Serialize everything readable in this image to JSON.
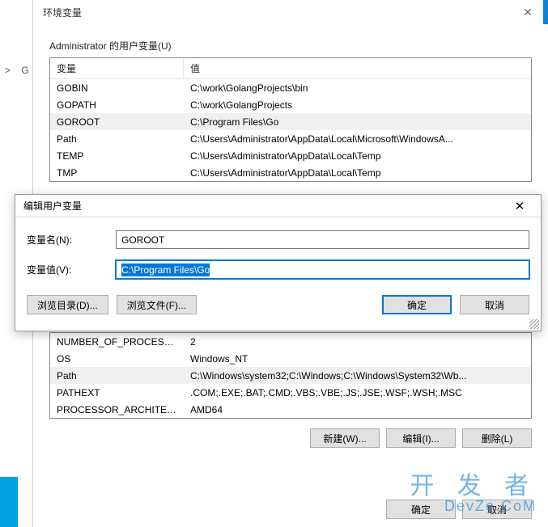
{
  "breadcrumb_sep": ">",
  "breadcrumb_item": "G",
  "main_dialog": {
    "title": "环境变量",
    "user_section_label": "Administrator 的用户变量(U)",
    "headers": {
      "name": "变量",
      "value": "值"
    },
    "user_vars": [
      {
        "name": "GOBIN",
        "value": "C:\\work\\GolangProjects\\bin"
      },
      {
        "name": "GOPATH",
        "value": "C:\\work\\GolangProjects"
      },
      {
        "name": "GOROOT",
        "value": "C:\\Program Files\\Go",
        "selected": true
      },
      {
        "name": "Path",
        "value": "C:\\Users\\Administrator\\AppData\\Local\\Microsoft\\WindowsA..."
      },
      {
        "name": "TEMP",
        "value": "C:\\Users\\Administrator\\AppData\\Local\\Temp"
      },
      {
        "name": "TMP",
        "value": "C:\\Users\\Administrator\\AppData\\Local\\Temp"
      }
    ],
    "system_vars": [
      {
        "name": "NUMBER_OF_PROCESSORS",
        "value": "2"
      },
      {
        "name": "OS",
        "value": "Windows_NT"
      },
      {
        "name": "Path",
        "value": "C:\\Windows\\system32;C:\\Windows;C:\\Windows\\System32\\Wb...",
        "selected": true
      },
      {
        "name": "PATHEXT",
        "value": ".COM;.EXE;.BAT;.CMD;.VBS;.VBE;.JS;.JSE;.WSF;.WSH;.MSC"
      },
      {
        "name": "PROCESSOR_ARCHITECT...",
        "value": "AMD64"
      }
    ],
    "buttons": {
      "new": "新建(W)...",
      "edit": "编辑(I)...",
      "delete": "删除(L)",
      "ok": "确定",
      "cancel": "取消"
    }
  },
  "edit_dialog": {
    "title": "编辑用户变量",
    "name_label": "变量名(N):",
    "value_label": "变量值(V):",
    "name_value": "GOROOT",
    "value_value": "C:\\Program Files\\Go",
    "browse_dir": "浏览目录(D)...",
    "browse_file": "浏览文件(F)...",
    "ok": "确定",
    "cancel": "取消"
  },
  "watermark": {
    "line1": "开 发 者",
    "line2": "DevZe.CoM"
  }
}
